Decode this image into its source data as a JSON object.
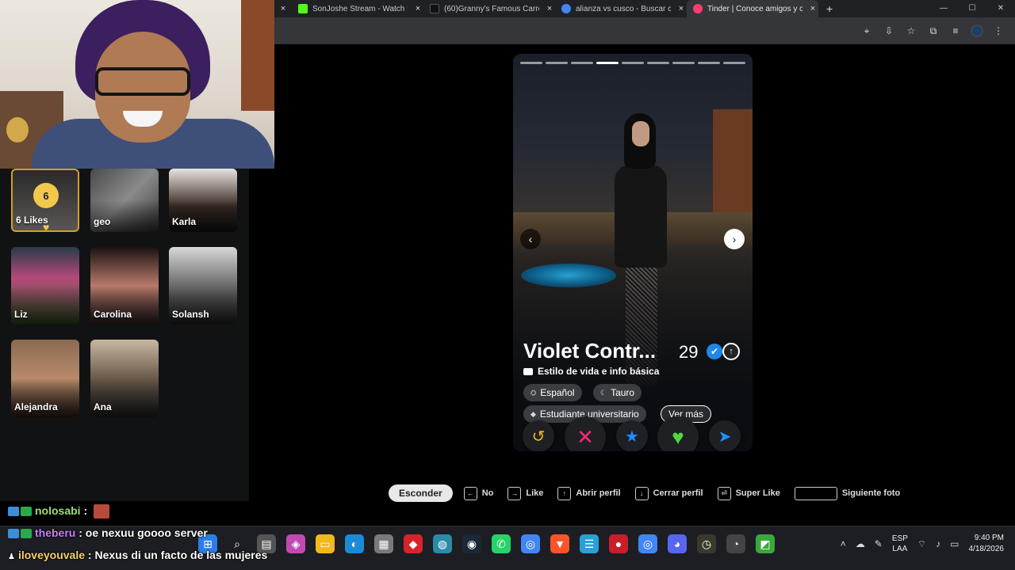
{
  "browser": {
    "tabs": [
      {
        "title": "SonJoshe Stream - Watch L",
        "icon_color": "#53fc18"
      },
      {
        "title": "(60)Granny's Famous Carro",
        "icon_color": "#111111"
      },
      {
        "title": "alianza vs cusco - Buscar c",
        "icon_color": "#4285f4"
      },
      {
        "title": "Tinder | Conoce amigos y c",
        "icon_color": "#fe3c72"
      }
    ],
    "new_tab": "+",
    "close_glyph": "×",
    "window_controls": [
      "—",
      "☐",
      "✕"
    ]
  },
  "likes_panel": {
    "likes_card": {
      "count": "6",
      "label": "6 Likes"
    },
    "cards": [
      {
        "name": "geo"
      },
      {
        "name": "Karla"
      },
      {
        "name": "Liz"
      },
      {
        "name": "Carolina"
      },
      {
        "name": "Solansh"
      },
      {
        "name": "Alejandra"
      },
      {
        "name": "Ana"
      }
    ]
  },
  "profile": {
    "name": "Violet Contr...",
    "age": "29",
    "lifestyle_label": "Estilo de vida e info básica",
    "chips": [
      "Español",
      "Tauro",
      "Estudiante universitario"
    ],
    "more_label": "Ver más",
    "photo_count": 9,
    "current_photo_index": 4,
    "colors": {
      "rewind": "#f0b323",
      "nope": "#fd267d",
      "superlike": "#1e8fff",
      "like": "#4fd83f",
      "boost": "#1e8fff"
    }
  },
  "shortcuts": {
    "hide_label": "Esconder",
    "items": [
      {
        "key": "←",
        "label": "No"
      },
      {
        "key": "→",
        "label": "Like"
      },
      {
        "key": "↑",
        "label": "Abrir perfil"
      },
      {
        "key": "↓",
        "label": "Cerrar perfil"
      },
      {
        "key": "⏎",
        "label": "Super Like"
      },
      {
        "key": "",
        "label": "Siguiente foto"
      }
    ]
  },
  "chat": [
    {
      "user": "nolosabi",
      "text": " : "
    },
    {
      "user": "theberu",
      "text": " : oe nexuu goooo server"
    },
    {
      "user": "iloveyouvale",
      "text": " : Nexus di un facto de las mujeres"
    }
  ],
  "taskbar": {
    "lang_1": "ESP",
    "lang_2": "LAA",
    "time": "9:40 PM",
    "date": "4/18/2026"
  }
}
